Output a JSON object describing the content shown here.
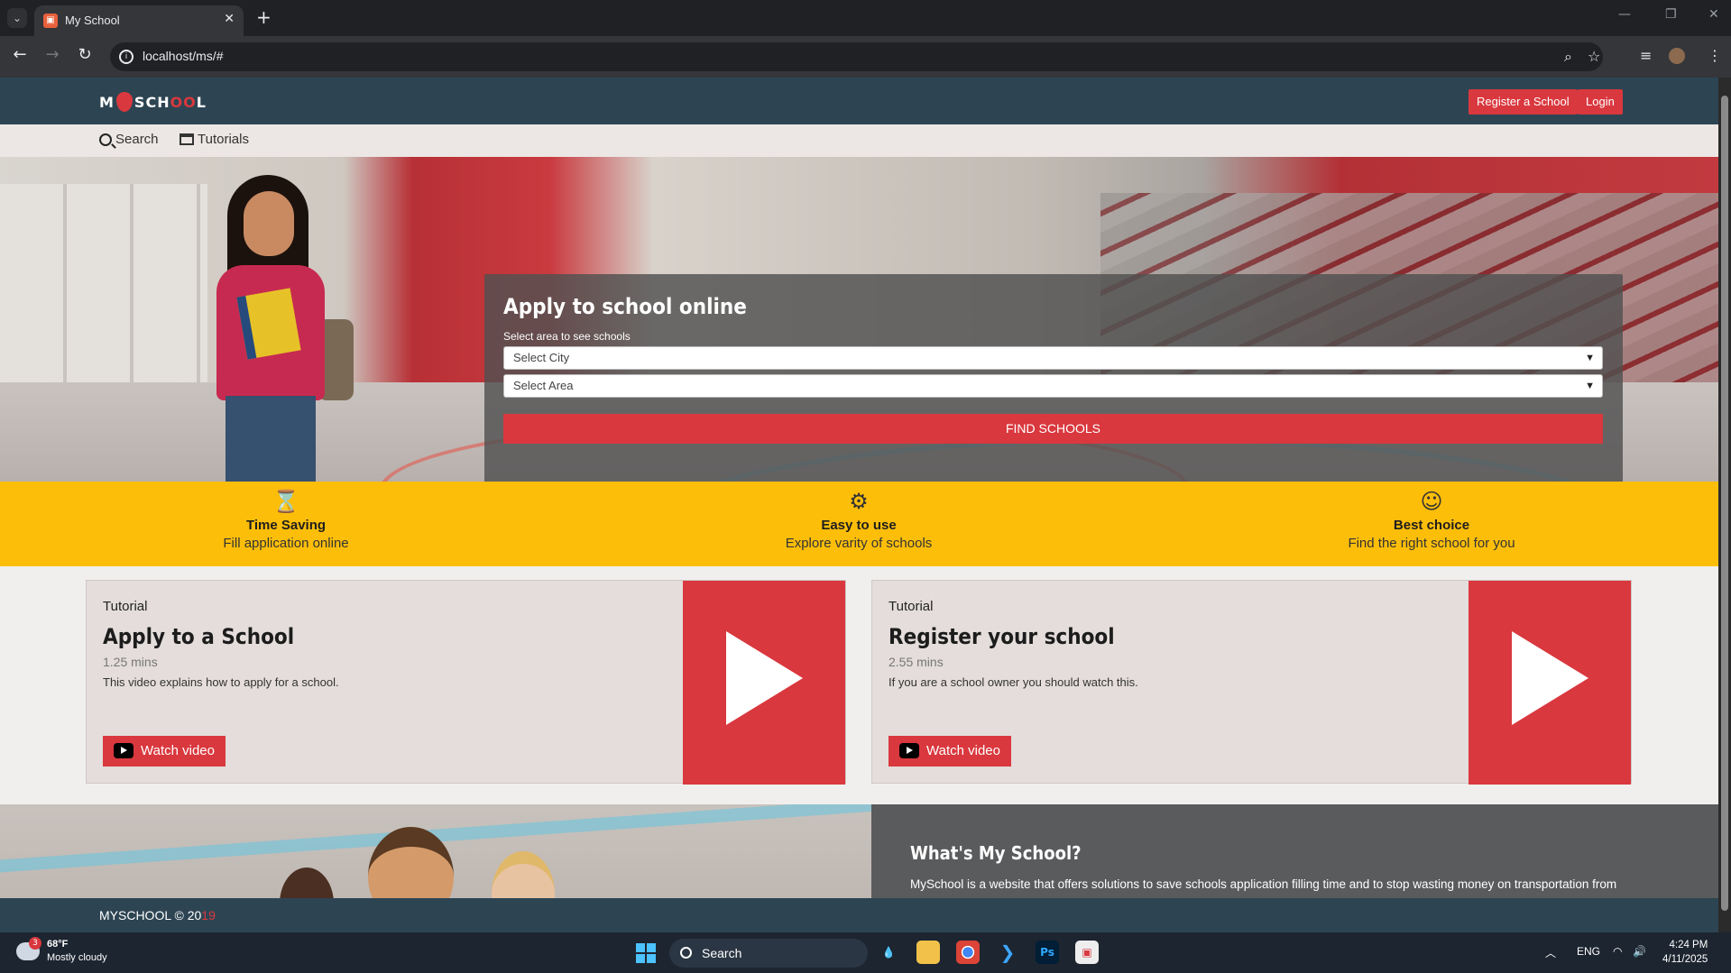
{
  "browser": {
    "tab_title": "My School",
    "url": "localhost/ms/#"
  },
  "header": {
    "logo_text_left": "M",
    "logo_text_right": "SCH",
    "logo_text_oo": "OO",
    "logo_text_end": "L",
    "register_label": "Register a School",
    "login_label": "Login"
  },
  "subnav": {
    "search_label": "Search",
    "tutorials_label": "Tutorials"
  },
  "hero": {
    "title": "Apply to school online",
    "subtitle": "Select area to see schools",
    "city_select": "Select City",
    "area_select": "Select Area",
    "find_button": "FIND SCHOOLS"
  },
  "features": [
    {
      "icon": "hourglass-icon",
      "title": "Time Saving",
      "desc": "Fill application online"
    },
    {
      "icon": "tools-icon",
      "title": "Easy to use",
      "desc": "Explore varity of schools"
    },
    {
      "icon": "graduate-icon",
      "title": "Best choice",
      "desc": "Find the right school for you"
    }
  ],
  "tutorials": [
    {
      "kicker": "Tutorial",
      "title": "Apply to a School",
      "mins": "1.25 mins",
      "desc": "This video explains how to apply for a school.",
      "button": "Watch video"
    },
    {
      "kicker": "Tutorial",
      "title": "Register your school",
      "mins": "2.55 mins",
      "desc": "If you are a school owner you should watch this.",
      "button": "Watch video"
    }
  ],
  "about": {
    "title": "What's My School?",
    "text": "MySchool is a website that offers solutions to save schools application filling time and to stop wasting money on transportation from"
  },
  "footer": {
    "text": "MYSCHOOL © 20",
    "year_suffix": "19"
  },
  "taskbar": {
    "temp": "68°F",
    "weather": "Mostly cloudy",
    "weather_badge": "3",
    "search": "Search",
    "lang": "ENG",
    "time": "4:24 PM",
    "date": "4/11/2025"
  },
  "colors": {
    "accent_red": "#d9383e",
    "header_navy": "#2d4553",
    "feature_yellow": "#fdbe0a"
  }
}
